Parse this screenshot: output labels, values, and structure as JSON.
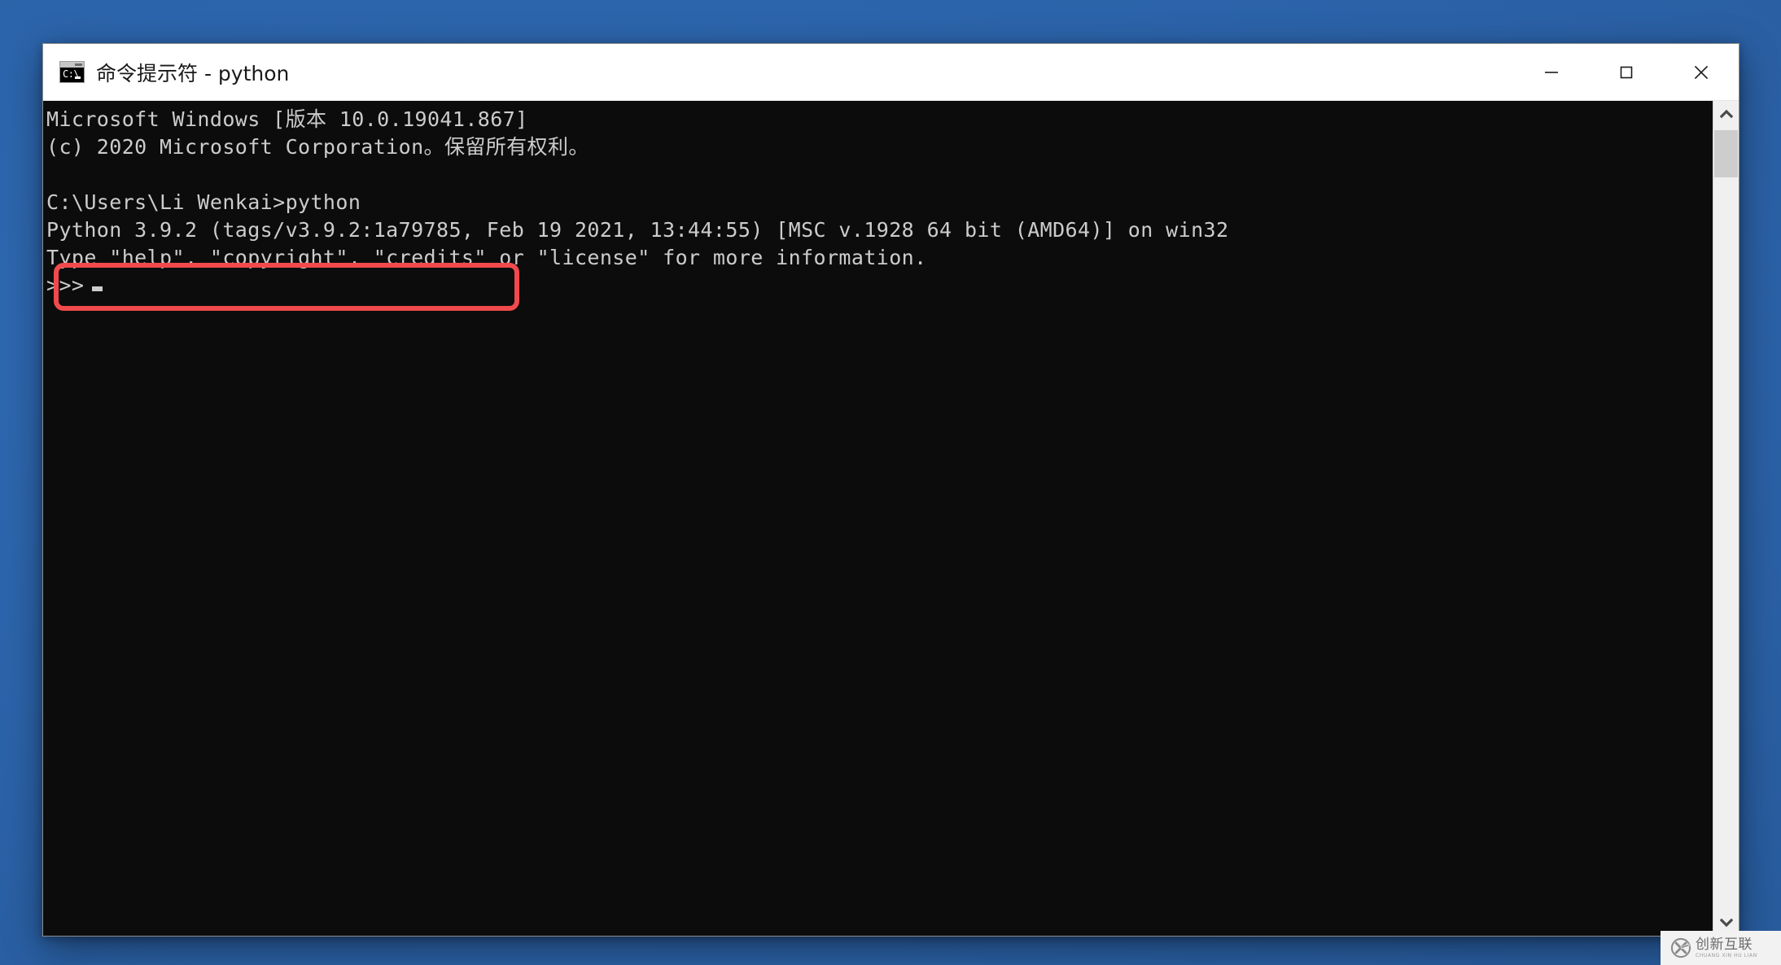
{
  "window": {
    "title": "命令提示符 - python",
    "icon": "console-icon",
    "controls": {
      "minimize": "minimize-icon",
      "maximize": "maximize-icon",
      "close": "close-icon"
    }
  },
  "terminal": {
    "background_color": "#0c0c0c",
    "text_color": "#cccccc",
    "lines": [
      "Microsoft Windows [版本 10.0.19041.867]",
      "(c) 2020 Microsoft Corporation。保留所有权利。",
      "",
      "C:\\Users\\Li Wenkai>python",
      "Python 3.9.2 (tags/v3.9.2:1a79785, Feb 19 2021, 13:44:55) [MSC v.1928 64 bit (AMD64)] on win32",
      "Type \"help\", \"copyright\", \"credits\" or \"license\" for more information.",
      ">>>"
    ],
    "prompt_line_index": 3,
    "cursor_visible": true
  },
  "annotation": {
    "type": "rounded-rectangle-highlight",
    "color": "#f04a4d",
    "target_text": "C:\\Users\\Li Wenkai>python"
  },
  "scrollbar": {
    "up_arrow": "chevron-up-icon",
    "down_arrow": "chevron-down-icon",
    "thumb_position": "top"
  },
  "watermark": {
    "logo": "circle-x-logo",
    "main_text": "创新互联",
    "sub_text": "CHUANG XIN HU LIAN"
  },
  "desktop": {
    "background_color": "#2b62a8"
  }
}
